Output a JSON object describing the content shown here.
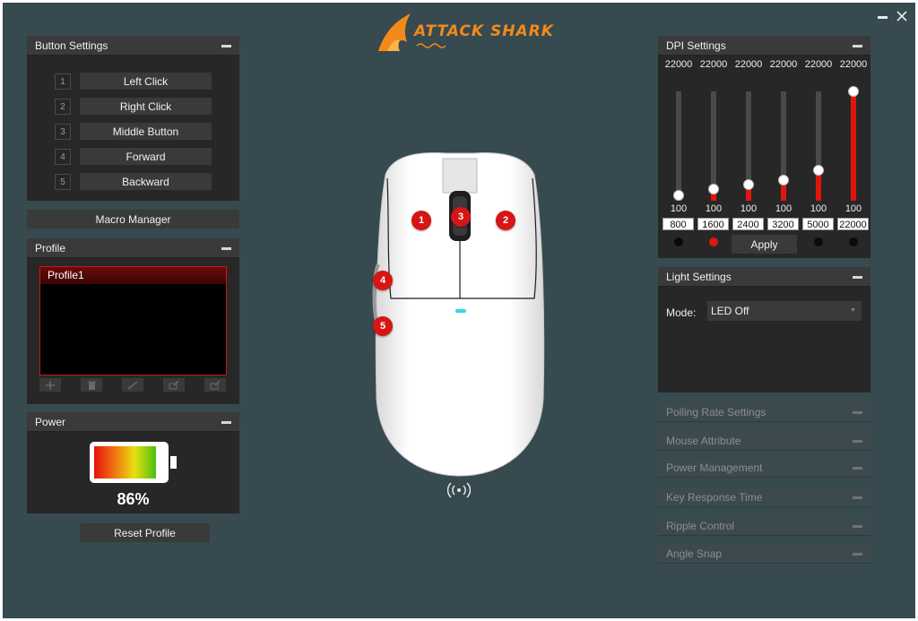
{
  "brand": {
    "name": "ATTACK SHARK",
    "accent": "#f28a1a"
  },
  "window": {
    "minimize_icon": "minimize-icon",
    "close_icon": "close-icon"
  },
  "button_settings": {
    "title": "Button Settings",
    "buttons": [
      {
        "num": "1",
        "label": "Left Click"
      },
      {
        "num": "2",
        "label": "Right Click"
      },
      {
        "num": "3",
        "label": "Middle Button"
      },
      {
        "num": "4",
        "label": "Forward"
      },
      {
        "num": "5",
        "label": "Backward"
      }
    ]
  },
  "macro": {
    "label": "Macro Manager"
  },
  "profile": {
    "title": "Profile",
    "items": [
      "Profile1"
    ],
    "tools": [
      "add-icon",
      "trash-icon",
      "edit-icon",
      "export-icon",
      "import-icon"
    ]
  },
  "power": {
    "title": "Power",
    "percent_label": "86%",
    "level": 0.86
  },
  "reset": {
    "label": "Reset Profile"
  },
  "mouse": {
    "markers": [
      "1",
      "2",
      "3",
      "4",
      "5"
    ],
    "wireless_icon": "wireless-signal-icon"
  },
  "dpi": {
    "title": "DPI Settings",
    "max_label": "22000",
    "min_label": "100",
    "max": 22000,
    "levels": [
      "800",
      "1600",
      "2400",
      "3200",
      "5000",
      "22000"
    ],
    "active_index": 1,
    "apply_label": "Apply",
    "fill_color": "#e0160c"
  },
  "light": {
    "title": "Light Settings",
    "mode_label": "Mode:",
    "mode_value": "LED Off"
  },
  "collapsed_sections": [
    "Polling Rate Settings",
    "Mouse Attribute",
    "Power Management",
    "Key Response Time",
    "Ripple Control",
    "Angle Snap"
  ]
}
